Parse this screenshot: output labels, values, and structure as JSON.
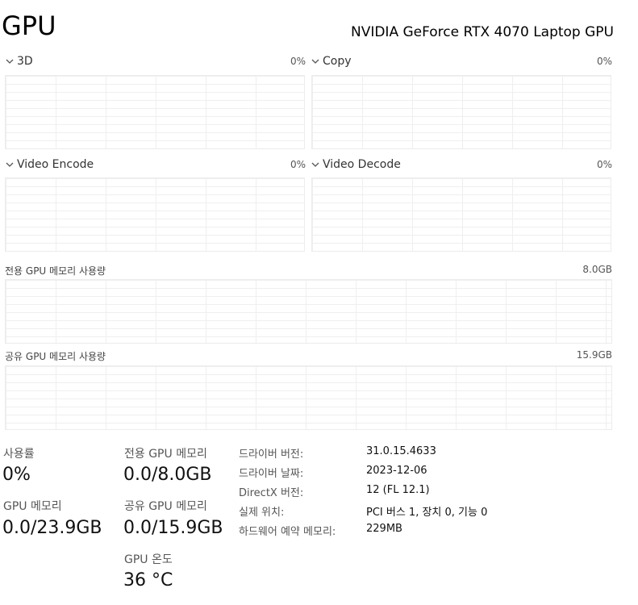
{
  "header": {
    "title": "GPU",
    "device": "NVIDIA GeForce RTX 4070 Laptop GPU"
  },
  "engines": [
    {
      "name": "3D",
      "value": "0%"
    },
    {
      "name": "Copy",
      "value": "0%"
    },
    {
      "name": "Video Encode",
      "value": "0%"
    },
    {
      "name": "Video Decode",
      "value": "0%"
    }
  ],
  "memory_graphs": {
    "dedicated": {
      "label": "전용 GPU 메모리 사용량",
      "max": "8.0GB"
    },
    "shared": {
      "label": "공유 GPU 메모리 사용량",
      "max": "15.9GB"
    }
  },
  "stats": {
    "utilization": {
      "label": "사용률",
      "value": "0%"
    },
    "dedicated_memory": {
      "label": "전용 GPU 메모리",
      "value": "0.0/8.0GB"
    },
    "gpu_memory": {
      "label": "GPU 메모리",
      "value": "0.0/23.9GB"
    },
    "shared_memory": {
      "label": "공유 GPU 메모리",
      "value": "0.0/15.9GB"
    },
    "temperature": {
      "label": "GPU 온도",
      "value": "36 °C"
    }
  },
  "info": [
    {
      "label": "드라이버 버전:",
      "value": "31.0.15.4633"
    },
    {
      "label": "드라이버 날짜:",
      "value": "2023-12-06"
    },
    {
      "label": "DirectX 버전:",
      "value": "12 (FL 12.1)"
    },
    {
      "label": "실제 위치:",
      "value": "PCI 버스 1, 장치 0, 기능 0"
    },
    {
      "label": "하드웨어 예약 메모리:",
      "value": "229MB"
    }
  ]
}
